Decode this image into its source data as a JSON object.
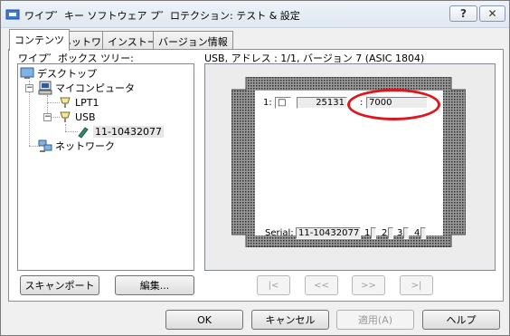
{
  "window": {
    "title": "ワイプ゛キー ソフトウェア プ゛ロテクション: テスト & 設定",
    "help_label": "?",
    "close_label": "✕"
  },
  "tabs": [
    {
      "label": "コンテンツ",
      "active": true
    },
    {
      "label": "ネットワーク",
      "active": false
    },
    {
      "label": "インストール",
      "active": false
    },
    {
      "label": "バージョン情報",
      "active": false
    }
  ],
  "tree": {
    "heading": "ワイプ゛ボックス ツリー:",
    "items": [
      {
        "label": "デスクトップ",
        "icon": "desktop-icon"
      },
      {
        "label": "マイコンピュータ",
        "icon": "my-computer-icon"
      },
      {
        "label": "LPT1",
        "icon": "parallel-port-icon"
      },
      {
        "label": "USB",
        "icon": "usb-port-icon"
      },
      {
        "label": "11-10432077",
        "icon": "usb-key-icon"
      },
      {
        "label": "ネットワーク",
        "icon": "network-icon"
      }
    ]
  },
  "device_info": {
    "heading": "USB, アドレス : 1/1, バージョン 7 (ASIC 1804)",
    "slot_label": "1:",
    "slot_value": "□",
    "memory_value": "25131",
    "separator": ":",
    "highlighted_value": "7000",
    "serial_label": "Serial:",
    "serial_value": "11-10432077",
    "ports": [
      "1",
      "2",
      "3",
      "4"
    ]
  },
  "buttons": {
    "scan_ports": "スキャンポート",
    "edit": "編集...",
    "first": "|<",
    "prev": "<<",
    "next": ">>",
    "last": ">|",
    "ok": "OK",
    "cancel": "キャンセル",
    "apply": "適用(A)",
    "help": "ヘルプ"
  },
  "colors": {
    "highlight_ellipse": "#e0161c",
    "selection": "#e6e6e6",
    "panel_bg": "#ececec"
  }
}
